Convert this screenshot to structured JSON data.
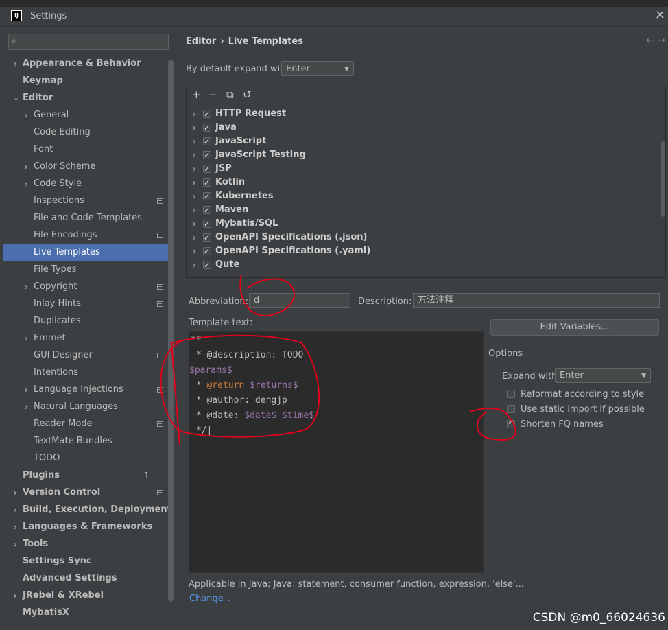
{
  "window": {
    "title": "Settings",
    "app_icon": "IJ"
  },
  "sidebar": {
    "search_placeholder": "",
    "items": [
      {
        "label": "Appearance & Behavior",
        "bold": true,
        "chevron": "right",
        "indent": 0
      },
      {
        "label": "Keymap",
        "bold": true,
        "chevron": "",
        "indent": 0
      },
      {
        "label": "Editor",
        "bold": true,
        "chevron": "down",
        "indent": 0
      },
      {
        "label": "General",
        "chevron": "right",
        "indent": 1
      },
      {
        "label": "Code Editing",
        "chevron": "",
        "indent": 1
      },
      {
        "label": "Font",
        "chevron": "",
        "indent": 1
      },
      {
        "label": "Color Scheme",
        "chevron": "right",
        "indent": 1
      },
      {
        "label": "Code Style",
        "chevron": "right",
        "indent": 1
      },
      {
        "label": "Inspections",
        "chevron": "",
        "indent": 1,
        "marker": true
      },
      {
        "label": "File and Code Templates",
        "chevron": "",
        "indent": 1
      },
      {
        "label": "File Encodings",
        "chevron": "",
        "indent": 1,
        "marker": true
      },
      {
        "label": "Live Templates",
        "chevron": "",
        "indent": 1,
        "selected": true
      },
      {
        "label": "File Types",
        "chevron": "",
        "indent": 1
      },
      {
        "label": "Copyright",
        "chevron": "right",
        "indent": 1,
        "marker": true
      },
      {
        "label": "Inlay Hints",
        "chevron": "",
        "indent": 1,
        "marker": true
      },
      {
        "label": "Duplicates",
        "chevron": "",
        "indent": 1
      },
      {
        "label": "Emmet",
        "chevron": "right",
        "indent": 1
      },
      {
        "label": "GUI Designer",
        "chevron": "",
        "indent": 1,
        "marker": true
      },
      {
        "label": "Intentions",
        "chevron": "",
        "indent": 1
      },
      {
        "label": "Language Injections",
        "chevron": "right",
        "indent": 1,
        "marker": true
      },
      {
        "label": "Natural Languages",
        "chevron": "right",
        "indent": 1
      },
      {
        "label": "Reader Mode",
        "chevron": "",
        "indent": 1,
        "marker": true
      },
      {
        "label": "TextMate Bundles",
        "chevron": "",
        "indent": 1
      },
      {
        "label": "TODO",
        "chevron": "",
        "indent": 1
      },
      {
        "label": "Plugins",
        "bold": true,
        "chevron": "",
        "indent": 0,
        "badge": "1"
      },
      {
        "label": "Version Control",
        "bold": true,
        "chevron": "right",
        "indent": 0,
        "marker": true
      },
      {
        "label": "Build, Execution, Deployment",
        "bold": true,
        "chevron": "right",
        "indent": 0
      },
      {
        "label": "Languages & Frameworks",
        "bold": true,
        "chevron": "right",
        "indent": 0
      },
      {
        "label": "Tools",
        "bold": true,
        "chevron": "right",
        "indent": 0
      },
      {
        "label": "Settings Sync",
        "bold": true,
        "chevron": "",
        "indent": 0
      },
      {
        "label": "Advanced Settings",
        "bold": true,
        "chevron": "",
        "indent": 0
      },
      {
        "label": "JRebel & XRebel",
        "bold": true,
        "chevron": "right",
        "indent": 0
      },
      {
        "label": "MybatisX",
        "bold": true,
        "chevron": "",
        "indent": 0
      }
    ]
  },
  "main": {
    "breadcrumb": {
      "parent": "Editor",
      "separator": "›",
      "current": "Live Templates"
    },
    "expand_label": "By default expand with",
    "expand_value": "Enter",
    "toolbar": {
      "add": "+",
      "remove": "−",
      "copy": "⧉",
      "restore": "↺"
    },
    "template_groups": [
      {
        "label": "HTTP Request",
        "checked": true
      },
      {
        "label": "Java",
        "checked": true
      },
      {
        "label": "JavaScript",
        "checked": true
      },
      {
        "label": "JavaScript Testing",
        "checked": true
      },
      {
        "label": "JSP",
        "checked": true
      },
      {
        "label": "Kotlin",
        "checked": true
      },
      {
        "label": "Kubernetes",
        "checked": true
      },
      {
        "label": "Maven",
        "checked": true
      },
      {
        "label": "Mybatis/SQL",
        "checked": true
      },
      {
        "label": "OpenAPI Specifications (.json)",
        "checked": true
      },
      {
        "label": "OpenAPI Specifications (.yaml)",
        "checked": true
      },
      {
        "label": "Qute",
        "checked": true
      }
    ],
    "abbreviation_label": "Abbreviation:",
    "abbreviation_value": "d",
    "description_label": "Description:",
    "description_value": "方法注释",
    "template_text_label": "Template text:",
    "edit_variables_button": "Edit Variables...",
    "code_lines": [
      "**",
      " * @description: TODO",
      "$params$",
      " * @return $returns$",
      " * @author: dengjp",
      " * @date: $date$ $time$",
      " */"
    ],
    "options": {
      "title": "Options",
      "expand_with_label": "Expand with",
      "expand_with_value": "Enter",
      "reformat": {
        "label": "Reformat according to style",
        "checked": false
      },
      "static_import": {
        "label": "Use static import if possible",
        "checked": false
      },
      "shorten_fq": {
        "label": "Shorten FQ names",
        "checked": true
      }
    },
    "applicable_text": "Applicable in Java; Java: statement, consumer function, expression, 'else'...",
    "change_link": "Change"
  },
  "watermark": "CSDN @m0_66024636",
  "colors": {
    "background": "#3c3f41",
    "selection": "#4b6eaf",
    "editor_bg": "#2b2b2b",
    "annotation": "#e0001b"
  }
}
